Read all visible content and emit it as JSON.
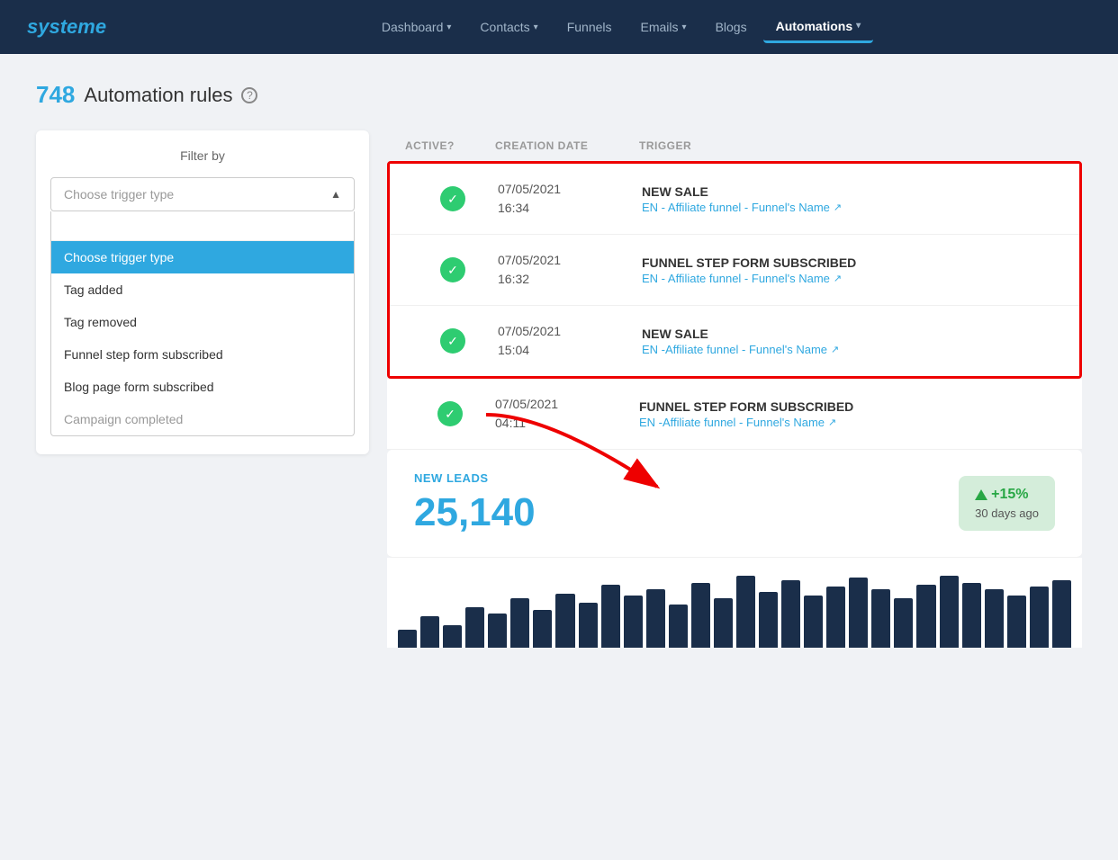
{
  "brand": "systeme",
  "navbar": {
    "items": [
      {
        "label": "Dashboard",
        "hasDropdown": true,
        "active": false
      },
      {
        "label": "Contacts",
        "hasDropdown": true,
        "active": false
      },
      {
        "label": "Funnels",
        "hasDropdown": false,
        "active": false
      },
      {
        "label": "Emails",
        "hasDropdown": true,
        "active": false
      },
      {
        "label": "Blogs",
        "hasDropdown": false,
        "active": false
      },
      {
        "label": "Automations",
        "hasDropdown": true,
        "active": true
      }
    ]
  },
  "page": {
    "count": "748",
    "title": "Automation rules",
    "help": "?"
  },
  "filter": {
    "title": "Filter by",
    "trigger_placeholder": "Choose trigger type",
    "search_placeholder": "",
    "options": [
      {
        "label": "Choose trigger type",
        "selected": true
      },
      {
        "label": "Tag added",
        "selected": false
      },
      {
        "label": "Tag removed",
        "selected": false
      },
      {
        "label": "Funnel step form subscribed",
        "selected": false
      },
      {
        "label": "Blog page form subscribed",
        "selected": false
      },
      {
        "label": "Campaign completed",
        "selected": false,
        "partial": true
      }
    ]
  },
  "table": {
    "headers": {
      "active": "ACTIVE?",
      "creation_date": "CREATION DATE",
      "trigger": "TRIGGER"
    },
    "highlighted_rows": [
      {
        "active": true,
        "date": "07/05/2021",
        "time": "16:34",
        "trigger_name": "NEW SALE",
        "trigger_sub": "EN - Affiliate funnel - Funnel's Name"
      },
      {
        "active": true,
        "date": "07/05/2021",
        "time": "16:32",
        "trigger_name": "FUNNEL STEP FORM SUBSCRIBED",
        "trigger_sub": "EN - Affiliate funnel - Funnel's Name"
      },
      {
        "active": true,
        "date": "07/05/2021",
        "time": "15:04",
        "trigger_name": "NEW SALE",
        "trigger_sub": "EN -Affiliate funnel - Funnel's Name"
      }
    ],
    "normal_rows": [
      {
        "active": true,
        "date": "07/05/2021",
        "time": "04:11",
        "trigger_name": "FUNNEL STEP FORM SUBSCRIBED",
        "trigger_sub": "EN -Affiliate funnel - Funnel's Name"
      }
    ]
  },
  "new_leads": {
    "label": "NEW LEADS",
    "value": "25,140",
    "badge_percent": "+15%",
    "badge_period": "30 days ago"
  },
  "chart": {
    "bars": [
      20,
      35,
      25,
      45,
      38,
      55,
      42,
      60,
      50,
      70,
      58,
      65,
      48,
      72,
      55,
      80,
      62,
      75,
      58,
      68,
      78,
      65,
      55,
      70,
      80,
      72,
      65,
      58,
      68,
      75
    ]
  }
}
